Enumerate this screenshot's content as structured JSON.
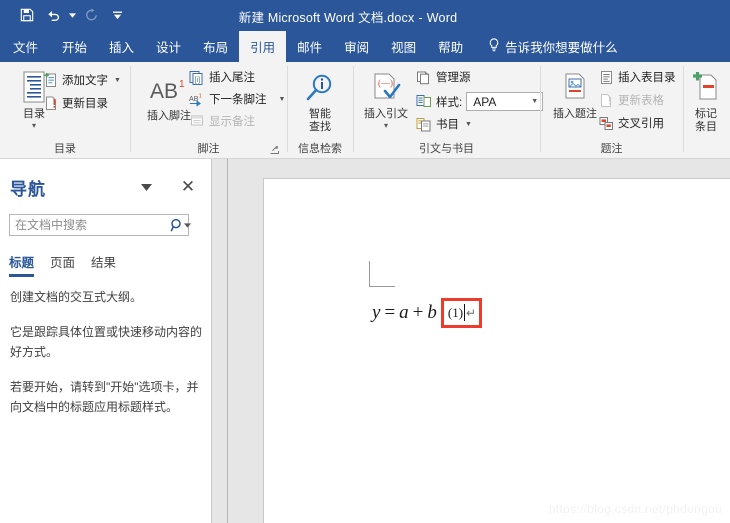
{
  "titlebar": {
    "document_name": "新建 Microsoft Word 文档.docx",
    "separator": "-",
    "app_name": "Word",
    "quick_access": [
      {
        "name": "save",
        "icon": "save-icon"
      },
      {
        "name": "undo",
        "icon": "undo-icon"
      },
      {
        "name": "redo",
        "icon": "redo-icon"
      },
      {
        "name": "customize",
        "icon": "customize-qat-icon"
      }
    ]
  },
  "tabs": [
    {
      "label": "文件",
      "active": false
    },
    {
      "label": "开始",
      "active": false
    },
    {
      "label": "插入",
      "active": false
    },
    {
      "label": "设计",
      "active": false
    },
    {
      "label": "布局",
      "active": false
    },
    {
      "label": "引用",
      "active": true
    },
    {
      "label": "邮件",
      "active": false
    },
    {
      "label": "审阅",
      "active": false
    },
    {
      "label": "视图",
      "active": false
    },
    {
      "label": "帮助",
      "active": false
    }
  ],
  "tell_me": "告诉我你想要做什么",
  "ribbon": {
    "groups": [
      {
        "label": "目录",
        "big_button": {
          "label": "目录",
          "has_dropdown": true
        },
        "items": [
          {
            "label": "添加文字",
            "dropdown": true,
            "disabled": false
          },
          {
            "label": "更新目录",
            "dropdown": false,
            "disabled": false
          }
        ]
      },
      {
        "label": "脚注",
        "big_button": {
          "label": "插入脚注",
          "glyph": "AB",
          "sup": "1"
        },
        "items": [
          {
            "label": "插入尾注",
            "dropdown": false,
            "disabled": false
          },
          {
            "label": "下一条脚注",
            "dropdown": true,
            "disabled": false
          },
          {
            "label": "显示备注",
            "dropdown": false,
            "disabled": true
          }
        ],
        "dialog_launcher": true
      },
      {
        "label": "信息检索",
        "big_button": {
          "label_line1": "智能",
          "label_line2": "查找"
        }
      },
      {
        "label": "引文与书目",
        "big_button": {
          "label": "插入引文",
          "has_dropdown": true
        },
        "items": [
          {
            "label": "管理源",
            "dropdown": false,
            "disabled": false
          },
          {
            "label": "样式:",
            "dropdown": false,
            "disabled": false,
            "combo_value": "APA"
          },
          {
            "label": "书目",
            "dropdown": true,
            "disabled": false
          }
        ]
      },
      {
        "label": "题注",
        "big_button": {
          "label": "插入题注"
        },
        "items": [
          {
            "label": "插入表目录",
            "dropdown": false,
            "disabled": false
          },
          {
            "label": "更新表格",
            "dropdown": false,
            "disabled": true
          },
          {
            "label": "交叉引用",
            "dropdown": false,
            "disabled": false
          }
        ]
      },
      {
        "label": "",
        "big_button": {
          "label_line1": "标记",
          "label_line2": "条目"
        }
      }
    ]
  },
  "navigation": {
    "title": "导航",
    "search_placeholder": "在文档中搜索",
    "search_value": "",
    "tabs": [
      {
        "label": "标题",
        "active": true
      },
      {
        "label": "页面",
        "active": false
      },
      {
        "label": "结果",
        "active": false
      }
    ],
    "body_paragraphs": [
      "创建文档的交互式大纲。",
      "它是跟踪具体位置或快速移动内容的好方式。",
      "若要开始，请转到\"开始\"选项卡，并向文档中的标题应用标题样式。"
    ]
  },
  "document": {
    "formula": {
      "lhs": "y",
      "equals": "=",
      "term_a": "a",
      "plus": "+",
      "term_b": "b",
      "equation_number": "(1)",
      "paragraph_mark": "↵"
    },
    "highlight_color": "#ef3b2b"
  },
  "watermark": "https://blog.csdn.net/phdongou",
  "colors": {
    "brand": "#2b579a",
    "ribbon_bg": "#f3f3f3",
    "workarea_bg": "#e6e6e6",
    "highlight_red": "#ef3b2b"
  }
}
